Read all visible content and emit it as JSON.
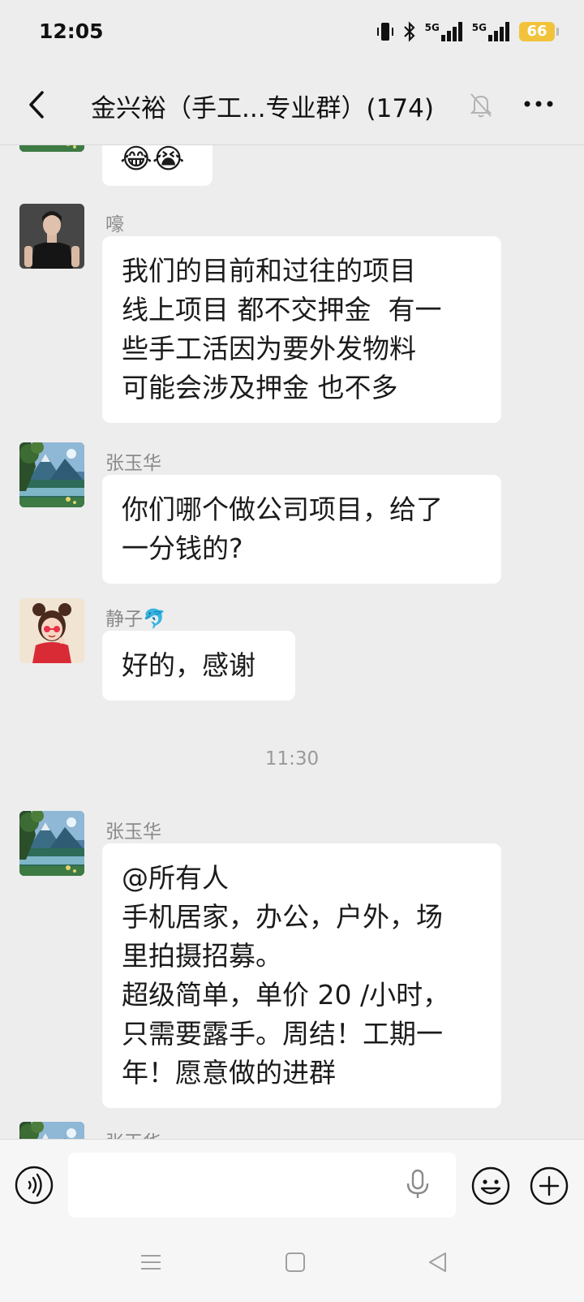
{
  "status_bar": {
    "time": "12:05",
    "network_1": "5G",
    "network_2": "5G",
    "battery": "66"
  },
  "header": {
    "title": "金兴裕（手工...专业群）(174)",
    "icons": [
      "back-arrow-icon",
      "mute-bell-icon",
      "more-dots-icon"
    ]
  },
  "messages": [
    {
      "sender": "",
      "avatar": "landscape-avatar",
      "lines": [
        "😂😭"
      ]
    },
    {
      "sender": "嚎",
      "avatar": "man-photo-avatar",
      "lines": [
        "我们的目前和过往的项目",
        "线上项目 都不交押金  有一",
        "些手工活因为要外发物料",
        "可能会涉及押金 也不多"
      ]
    },
    {
      "sender": "张玉华",
      "avatar": "landscape-avatar",
      "lines": [
        "你们哪个做公司项目，给了",
        "一分钱的?"
      ]
    },
    {
      "sender": "静子🐬",
      "avatar": "girl-cartoon-avatar",
      "lines": [
        "好的，感谢"
      ]
    },
    {
      "sender": "张玉华",
      "avatar": "landscape-avatar",
      "lines": [
        "@所有人",
        "手机居家，办公，户外，场",
        "里拍摄招募。",
        "超级简单，单价 20 /小时，",
        "只需要露手。周结！工期一",
        "年！愿意做的进群"
      ]
    },
    {
      "sender": "张玉华",
      "avatar": "landscape-avatar",
      "lines": []
    }
  ],
  "timestamp": "11:30",
  "input_bar": {
    "value": "",
    "icons": [
      "voice-icon",
      "microphone-icon",
      "emoji-icon",
      "plus-icon"
    ]
  },
  "nav_bar": {
    "icons": [
      "menu-icon",
      "home-icon",
      "back-triangle-icon"
    ]
  }
}
